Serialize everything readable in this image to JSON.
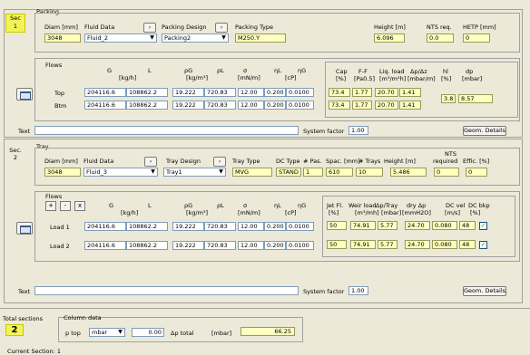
{
  "packing": {
    "sec_label": "Sec",
    "sec_num": "1",
    "title": "Packing",
    "diam_label": "Diam [mm]",
    "fluid_label": "Fluid Data",
    "design_label": "Packing Design",
    "type_label": "Packing Type",
    "height_label": "Height  [m]",
    "nts_label": "NTS req.",
    "hetp_label": "HETP [mm]",
    "diam": "3048",
    "fluid": "Fluid_2",
    "design": "Packing2",
    "type": "M250.Y",
    "height": "6.096",
    "nts": "0.0",
    "hetp": "0",
    "flows_label": "Flows",
    "col_headers": [
      "G",
      "[kg/h]",
      "L",
      "ρG",
      "[kg/m³]",
      "ρL",
      "σ",
      "[mN/m]",
      "ηL",
      "[cP]",
      "ηG"
    ],
    "rows": [
      {
        "label": "Top",
        "g": "204116.6",
        "l": "108862.2",
        "rhog": "19.222",
        "rhol": "720.83",
        "sigma": "12.00",
        "etal": "0.200",
        "etag": "0.0100"
      },
      {
        "label": "Btm",
        "g": "204116.6",
        "l": "108862.2",
        "rhog": "19.222",
        "rhol": "720.83",
        "sigma": "12.00",
        "etal": "0.200",
        "etag": "0.0100"
      }
    ],
    "res_headers": [
      "Cap",
      "[%]",
      "F-F",
      "[Pa0.5]",
      "Liq. load",
      "[m³/m²h]",
      "Δp/Δz",
      "[mbar/m]",
      "hl",
      "[%]",
      "dp",
      "[mbar]"
    ],
    "res_rows": [
      {
        "cap": "73.4",
        "ff": "1.77",
        "liq": "20.70",
        "dpdz": "1.41"
      },
      {
        "cap": "73.4",
        "ff": "1.77",
        "liq": "20.70",
        "dpdz": "1.41"
      }
    ],
    "hl": "3.8",
    "dp": "8.57",
    "text_label": "Text",
    "sysfactor_label": "System factor",
    "sysfactor": "1.00",
    "geom_button": "Geom. Details"
  },
  "tray": {
    "sec_label": "Sec.",
    "sec_num": "2",
    "title": "Tray",
    "diam_label": "Diam [mm]",
    "fluid_label": "Fluid Data",
    "design_label": "Tray Design",
    "type_label": "Tray Type",
    "dc_label": "DC Type",
    "pas_label": "# Pas.",
    "spac_label": "Spac. [mm]",
    "ntrays_label": "# Trays",
    "height_label": "Height [m]",
    "nts_label1": "NTS",
    "nts_label2": "required",
    "effic_label": "Effic. [%]",
    "diam": "3048",
    "fluid": "Fluid_3",
    "design": "Tray1",
    "type": "MVG",
    "dc": "STAND",
    "pas": "1",
    "spac": "610",
    "ntrays": "10",
    "height": "5.486",
    "nts": "0",
    "effic": "0",
    "flows_label": "Flows",
    "ctrl_plus": "+",
    "ctrl_minus": "-",
    "ctrl_x": "x",
    "col_headers": [
      "G",
      "[kg/h]",
      "L",
      "ρG",
      "[kg/m³]",
      "ρL",
      "σ",
      "[mN/m]",
      "ηL",
      "[cP]",
      "ηG"
    ],
    "rows": [
      {
        "label": "Load 1",
        "g": "204116.6",
        "l": "108862.2",
        "rhog": "19.222",
        "rhol": "720.83",
        "sigma": "12.00",
        "etal": "0.200",
        "etag": "0.0100"
      },
      {
        "label": "Load 2",
        "g": "204116.6",
        "l": "108862.2",
        "rhog": "19.222",
        "rhol": "720.83",
        "sigma": "12.00",
        "etal": "0.200",
        "etag": "0.0100"
      }
    ],
    "res_headers": [
      "Jet Fl.",
      "[%]",
      "Weir load",
      "[m³/mh]",
      "Δp/Tray",
      "[mbar]",
      "dry Δp",
      "[mmH2O]",
      "DC vel",
      "[m/s]",
      "DC bkp",
      "[%]"
    ],
    "res_rows": [
      {
        "jet": "50",
        "weir": "74.91",
        "dptray": "5.77",
        "dry": "24.70",
        "dcvel": "0.080",
        "dcbkp": "48"
      },
      {
        "jet": "50",
        "weir": "74.91",
        "dptray": "5.77",
        "dry": "24.70",
        "dcvel": "0.080",
        "dcbkp": "48"
      }
    ],
    "text_label": "Text",
    "sysfactor_label": "System factor",
    "sysfactor": "1.00",
    "geom_button": "Geom. Details"
  },
  "bottom": {
    "total_label": "Total sections",
    "total": "2",
    "coldata_label": "Column data",
    "ptop_label": "p top",
    "unit": "mbar",
    "ptop": "0.00",
    "dptotal_label": "Δp total",
    "dptotal_unit": "[mbar]",
    "dptotal": "66.25",
    "status": "Current Section: 1"
  }
}
